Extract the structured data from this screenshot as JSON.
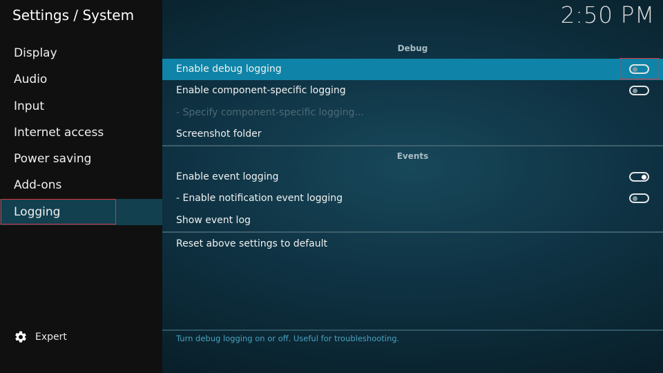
{
  "header": {
    "title": "Settings / System",
    "clock": "2:50 PM"
  },
  "sidebar": {
    "items": [
      {
        "label": "Display"
      },
      {
        "label": "Audio"
      },
      {
        "label": "Input"
      },
      {
        "label": "Internet access"
      },
      {
        "label": "Power saving"
      },
      {
        "label": "Add-ons"
      },
      {
        "label": "Logging",
        "active": true
      }
    ],
    "expert": {
      "label": "Expert",
      "icon": "gear-icon"
    }
  },
  "sections": {
    "debug": {
      "header": "Debug",
      "items": {
        "enable_debug_logging": {
          "label": "Enable debug logging",
          "enabled": false
        },
        "enable_component_logging": {
          "label": "Enable component-specific logging",
          "enabled": false
        },
        "specify_component_logging": {
          "label": "- Specify component-specific logging..."
        },
        "screenshot_folder": {
          "label": "Screenshot folder"
        }
      }
    },
    "events": {
      "header": "Events",
      "items": {
        "enable_event_logging": {
          "label": "Enable event logging",
          "enabled": true
        },
        "enable_notification_logging": {
          "label": "- Enable notification event logging",
          "enabled": false
        },
        "show_event_log": {
          "label": "Show event log"
        }
      }
    },
    "reset": {
      "label": "Reset above settings to default"
    }
  },
  "footer": {
    "help_text": "Turn debug logging on or off. Useful for troubleshooting."
  },
  "colors": {
    "focus": "#0f84a8",
    "highlight_border": "#e0333a",
    "help_text": "#4aa3c2"
  }
}
